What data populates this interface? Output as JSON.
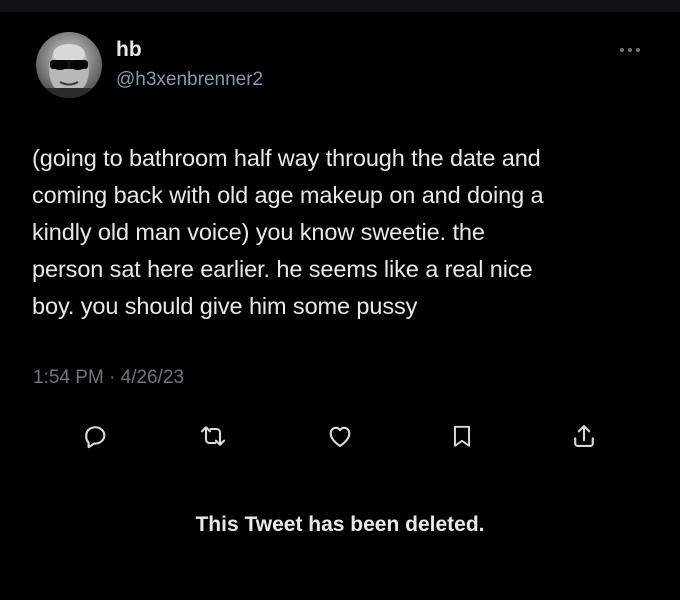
{
  "author": {
    "name": "hb",
    "handle": "@h3xenbrenner2"
  },
  "tweet": {
    "text": "(going to bathroom half way through the date and\ncoming back with old age makeup on and doing a\nkindly old man voice) you know sweetie. the\nperson sat here earlier. he seems like a real nice\nboy. you should give him some pussy",
    "timestamp": "1:54 PM · 4/26/23"
  },
  "actions": [
    "reply-icon",
    "retweet-icon",
    "like-icon",
    "bookmark-icon",
    "share-icon"
  ],
  "notice": {
    "deleted_text": "This Tweet has been deleted."
  },
  "colors": {
    "background": "#000000",
    "text": "#e7e9ea",
    "secondary": "#71767b",
    "icon": "#8b98a5"
  }
}
